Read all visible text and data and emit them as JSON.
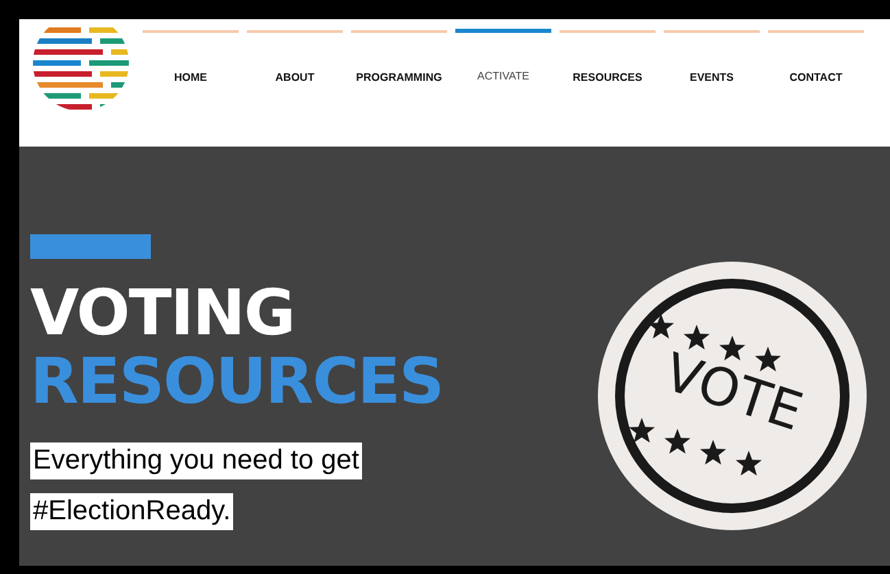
{
  "nav": [
    {
      "label": "HOME",
      "selected": false
    },
    {
      "label": "ABOUT",
      "selected": false
    },
    {
      "label": "PROGRAMMING",
      "selected": false
    },
    {
      "label": "ACTIVATE",
      "selected": true
    },
    {
      "label": "RESOURCES",
      "selected": false
    },
    {
      "label": "EVENTS",
      "selected": false
    },
    {
      "label": "CONTACT",
      "selected": false
    }
  ],
  "hero": {
    "title_line_1": "VOTING",
    "title_line_2": "RESOURCES",
    "subtitle_lines": [
      "Everything you need to get",
      "#ElectionReady."
    ],
    "badge_text": "VOTE"
  }
}
